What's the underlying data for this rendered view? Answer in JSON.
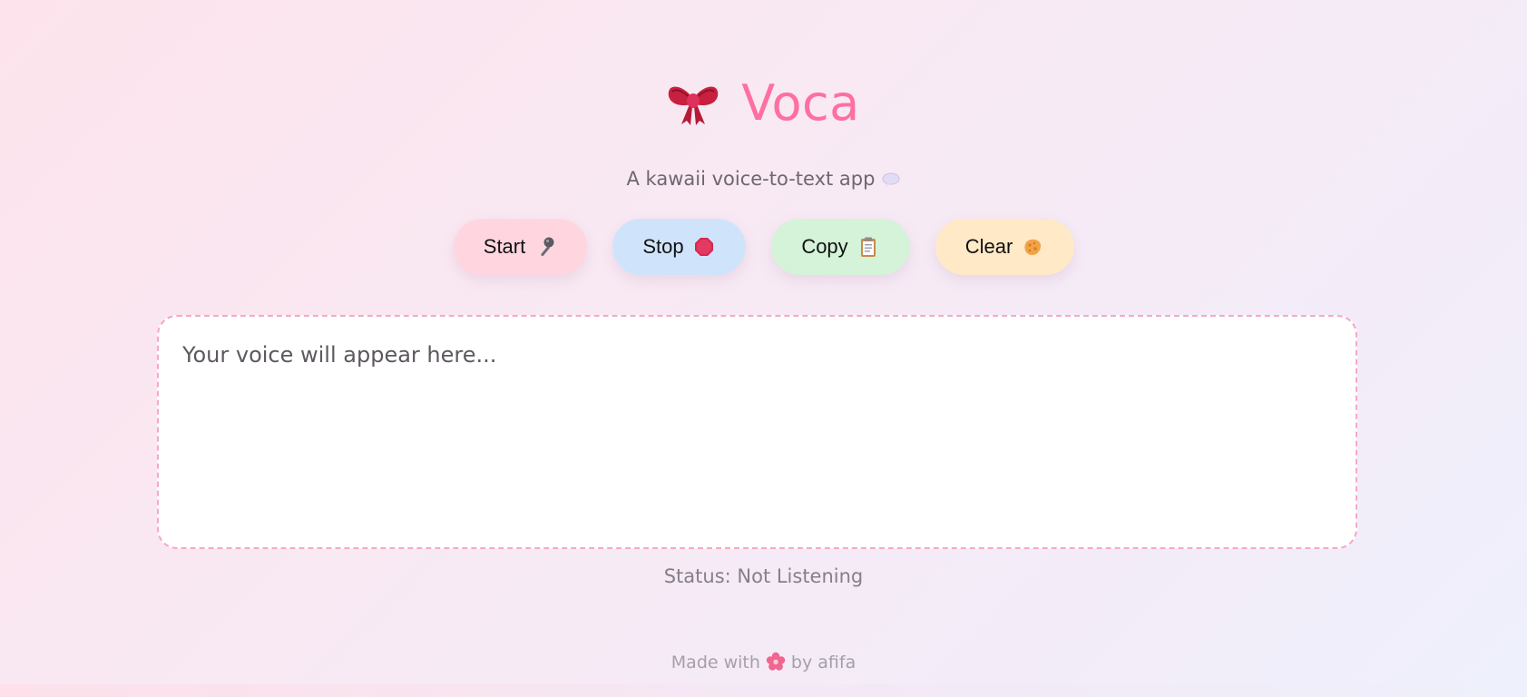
{
  "header": {
    "icon": "ribbon-bow-icon",
    "title": "Voca"
  },
  "subtitle": {
    "text": "A kawaii voice-to-text app",
    "icon": "speech-bubble-icon"
  },
  "controls": {
    "start": {
      "label": "Start",
      "icon": "microphone-icon",
      "bg": "#ffd6e0"
    },
    "stop": {
      "label": "Stop",
      "icon": "stop-sign-icon",
      "bg": "#cfe4fb"
    },
    "copy": {
      "label": "Copy",
      "icon": "clipboard-icon",
      "bg": "#d4f3d8"
    },
    "clear": {
      "label": "Clear",
      "icon": "sponge-icon",
      "bg": "#ffe9c7"
    }
  },
  "output": {
    "placeholder": "Your voice will appear here...",
    "value": ""
  },
  "status": {
    "text": "Status: Not Listening"
  },
  "footer": {
    "prefix": "Made with",
    "icon": "cherry-blossom-icon",
    "suffix": "by afifa"
  },
  "colors": {
    "accent": "#ff6fa0",
    "border": "#f7a8c4"
  }
}
